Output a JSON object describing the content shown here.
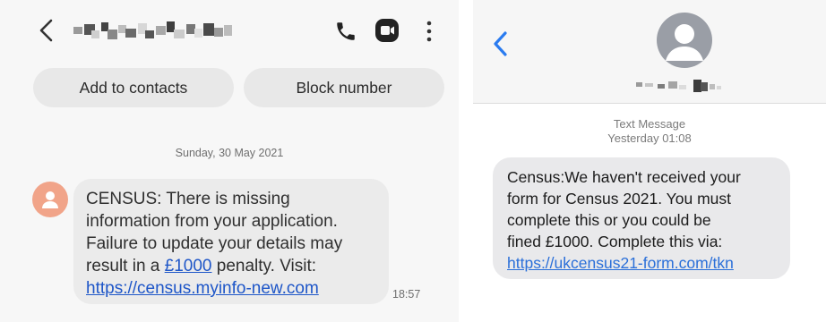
{
  "android": {
    "actions": {
      "add_contacts": "Add to contacts",
      "block_number": "Block number"
    },
    "date_separator": "Sunday, 30 May 2021",
    "message": {
      "line1": "CENSUS: There is missing",
      "line2": "information from your application.",
      "line3": "Failure to update your details may",
      "line4_prefix": "result in a ",
      "amount": "£1000",
      "line4_suffix": " penalty. Visit:",
      "link": "https://census.myinfo-new.com"
    },
    "time": "18:57",
    "colors": {
      "avatar": "#f1a489",
      "link": "#1e56c8",
      "bubble": "#ebebeb"
    }
  },
  "ios": {
    "meta": {
      "label": "Text Message",
      "time": "Yesterday 01:08"
    },
    "message": {
      "line1": "Census:We haven't received your",
      "line2": "form for Census 2021. You must",
      "line3": "complete this or you could be",
      "line4": "fined £1000. Complete this via:",
      "link": "https://ukcensus21-form.com/tkn"
    },
    "colors": {
      "back": "#2a7bf0",
      "link": "#2a6fd9",
      "bubble": "#e9e9eb"
    }
  }
}
